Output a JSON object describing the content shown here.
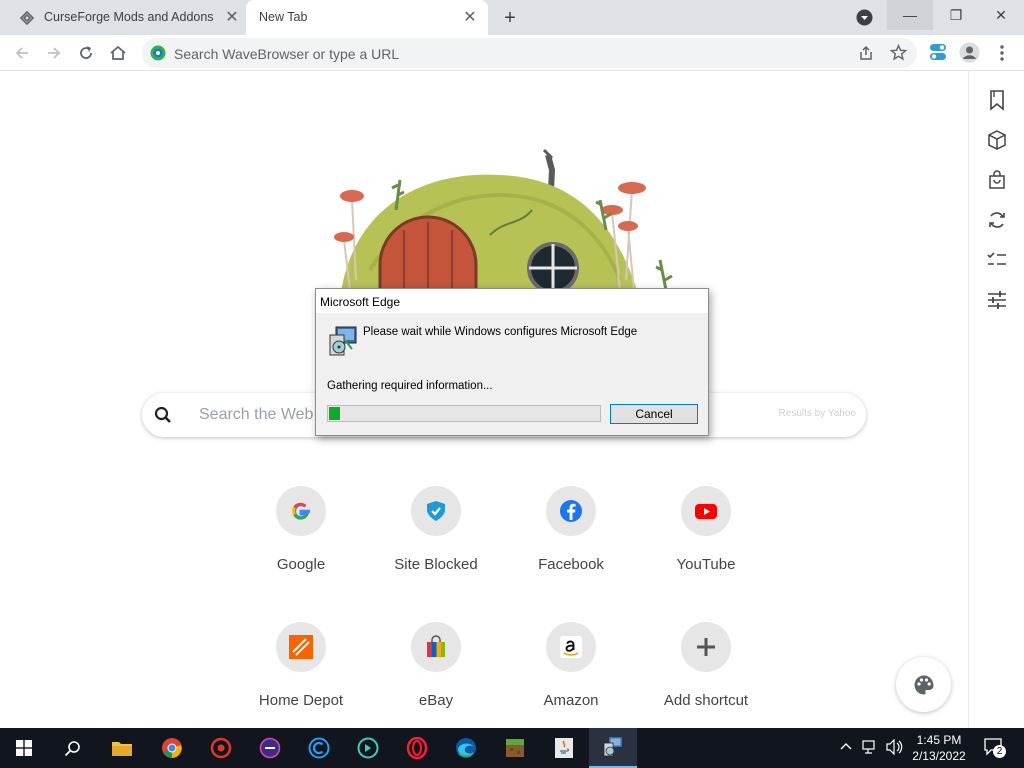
{
  "browser": {
    "tabs": [
      {
        "title": "CurseForge Mods and Addons -",
        "close": "✕"
      },
      {
        "title": "New Tab",
        "close": "✕"
      }
    ],
    "new_tab_symbol": "+",
    "window_controls": {
      "minimize": "—",
      "restore": "❐",
      "close": "✕"
    },
    "omnibox_placeholder": "Search WaveBrowser or type a URL"
  },
  "newtab": {
    "search_placeholder": "Search the Web",
    "search_credit": "Results by Yahoo",
    "shortcuts": [
      {
        "label": "Google",
        "icon": "google-icon"
      },
      {
        "label": "Site Blocked",
        "icon": "shield-icon"
      },
      {
        "label": "Facebook",
        "icon": "facebook-icon"
      },
      {
        "label": "YouTube",
        "icon": "youtube-icon"
      },
      {
        "label": "Home Depot",
        "icon": "home-depot-icon"
      },
      {
        "label": "eBay",
        "icon": "ebay-icon"
      },
      {
        "label": "Amazon",
        "icon": "amazon-icon"
      },
      {
        "label": "Add shortcut",
        "icon": "plus-icon"
      }
    ]
  },
  "dialog": {
    "title": "Microsoft Edge",
    "message": "Please wait while Windows configures Microsoft Edge",
    "status": "Gathering required information...",
    "progress": 0.04,
    "cancel_label": "Cancel"
  },
  "taskbar": {
    "time": "1:45 PM",
    "date": "2/13/2022",
    "notification_count": "2"
  },
  "colors": {
    "progress_fill": "#06b025",
    "taskbar": "#10151e",
    "accent": "#0078d7"
  }
}
